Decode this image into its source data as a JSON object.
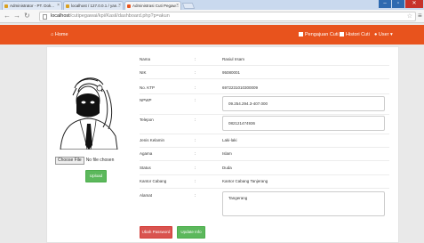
{
  "browser": {
    "tabs": [
      {
        "label": "Administrator - PT. Dok..."
      },
      {
        "label": "localhost / 127.0.0.1 / yan..."
      },
      {
        "label": "Administrasi Cuti Pegaw..."
      }
    ],
    "url_host": "localhost",
    "url_path": "/cutipegawai/kpi/Kasil/dashboard.php?p=akun",
    "window_controls": [
      "–",
      "▫",
      "✕"
    ]
  },
  "navbar": {
    "brand": "Home",
    "links": [
      "Pengajuan Cuti",
      "Histori Cuti",
      "User"
    ]
  },
  "profile": {
    "file_button": "Choose File",
    "file_status": "No file chosen",
    "upload_label": "Upload",
    "rows": [
      {
        "label": "Nama",
        "value": "Rasiul Irsam"
      },
      {
        "label": "NIK",
        "value": "95080001"
      },
      {
        "label": "No. KTP",
        "value": "6972231010300009"
      },
      {
        "label": "NPWP",
        "value": "09.254.294.3-407.000"
      },
      {
        "label": "Telepon",
        "value": "082121474936"
      },
      {
        "label": "Jenis Kelamin",
        "value": "Laki-laki"
      },
      {
        "label": "Agama",
        "value": "Islam"
      },
      {
        "label": "Status",
        "value": "Duda"
      },
      {
        "label": "Kantor Cabang",
        "value": "Kantor Cabang Tanjerang"
      },
      {
        "label": "Alamat",
        "value": "Tangerang"
      }
    ],
    "colon": ":",
    "ubah_password": "Ubah Password",
    "update_info": "Update Info"
  },
  "colors": {
    "navbar": "#e8531d",
    "success": "#5cb85c",
    "danger": "#d9534f"
  }
}
